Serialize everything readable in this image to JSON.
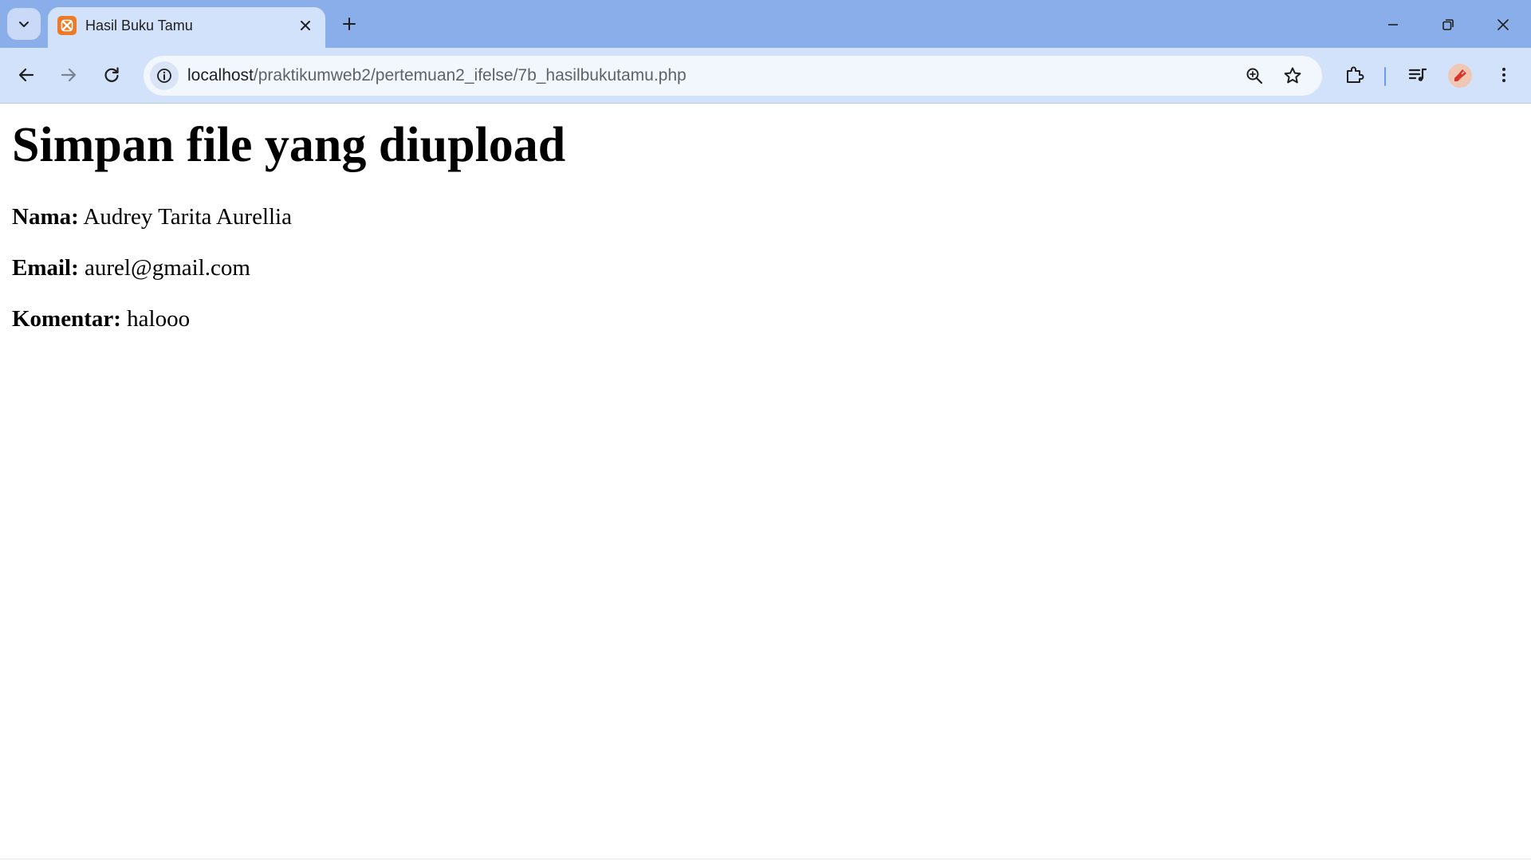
{
  "browser": {
    "tab": {
      "title": "Hasil Buku Tamu",
      "favicon": "xampp-icon"
    },
    "address": {
      "host": "localhost",
      "path": "/praktikumweb2/pertemuan2_ifelse/7b_hasilbukutamu.php"
    },
    "colors": {
      "frame": "#8aaeea",
      "toolbar": "#d3e2fb",
      "omnibox": "#f2f6fd"
    }
  },
  "page": {
    "title": "Simpan file yang diupload",
    "fields": [
      {
        "label": "Nama:",
        "value": "Audrey Tarita Aurellia"
      },
      {
        "label": "Email:",
        "value": "aurel@gmail.com"
      },
      {
        "label": "Komentar:",
        "value": "halooo"
      }
    ]
  }
}
